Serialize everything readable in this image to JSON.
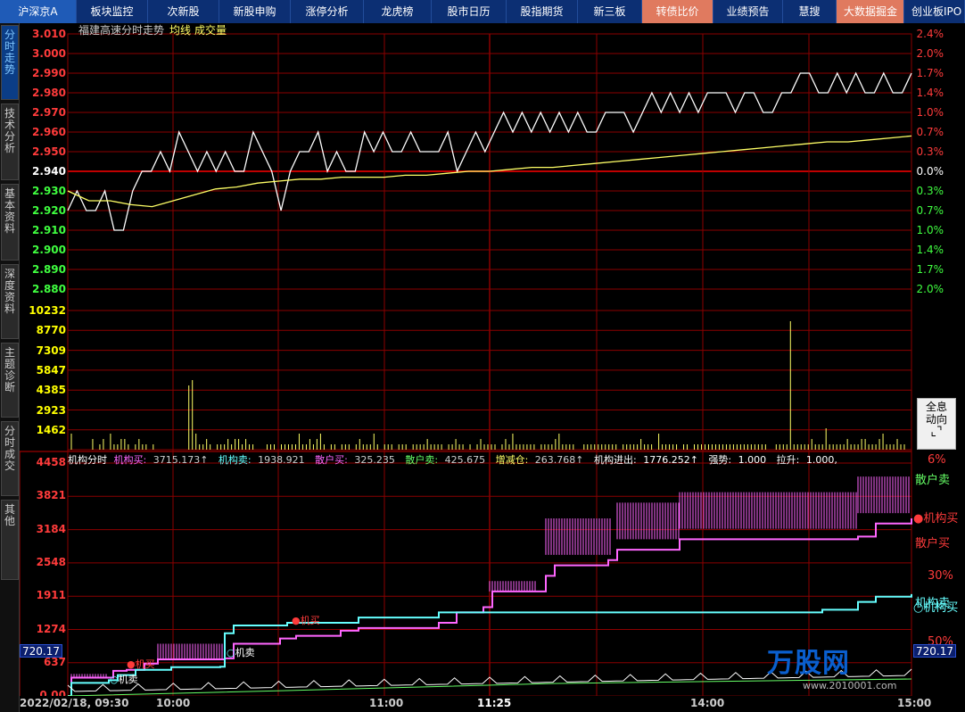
{
  "topnav": {
    "tabs": [
      {
        "label": "沪深京A",
        "style": "first"
      },
      {
        "label": "板块监控"
      },
      {
        "label": "次新股"
      },
      {
        "label": "新股申购"
      },
      {
        "label": "涨停分析"
      },
      {
        "label": "龙虎榜"
      },
      {
        "label": "股市日历"
      },
      {
        "label": "股指期货"
      },
      {
        "label": "新三板"
      },
      {
        "label": "转债比价",
        "style": "hl"
      },
      {
        "label": "业绩预告"
      },
      {
        "label": "慧搜"
      },
      {
        "label": "大数据掘金",
        "style": "hl"
      },
      {
        "label": "创业板IPO"
      }
    ]
  },
  "sidetabs": [
    {
      "label": "分时走势",
      "active": true
    },
    {
      "label": "技术分析"
    },
    {
      "label": "基本资料"
    },
    {
      "label": "深度资料"
    },
    {
      "label": "主题诊断"
    },
    {
      "label": "分时成交"
    },
    {
      "label": "其他"
    }
  ],
  "chart_title": {
    "name": "福建高速分时走势",
    "ma": "均线",
    "vol": "成交量"
  },
  "price_axis": {
    "left": [
      "3.010",
      "3.000",
      "2.990",
      "2.980",
      "2.970",
      "2.960",
      "2.950",
      "2.940",
      "2.930",
      "2.920",
      "2.910",
      "2.900",
      "2.890",
      "2.880"
    ],
    "right": [
      "2.4%",
      "2.0%",
      "1.7%",
      "1.4%",
      "1.0%",
      "0.7%",
      "0.3%",
      "0.0%",
      "0.3%",
      "0.7%",
      "1.0%",
      "1.4%",
      "1.7%",
      "2.0%"
    ]
  },
  "volume_axis": [
    "10232",
    "8770",
    "7309",
    "5847",
    "4385",
    "2923",
    "1462"
  ],
  "indicator": {
    "name": "机构分时",
    "inst_buy_label": "机构买:",
    "inst_buy_val": "3715.173↑",
    "inst_sell_label": "机构卖:",
    "inst_sell_val": "1938.921",
    "retail_buy_label": "散户买:",
    "retail_buy_val": "325.235",
    "retail_sell_label": "散户卖:",
    "retail_sell_val": "425.675",
    "change_label": "增减仓:",
    "change_val": "263.768↑",
    "net_label": "机构进出:",
    "net_val": "1776.252↑",
    "strength_label": "强势:",
    "strength_val": "1.000",
    "pull_label": "拉升:",
    "pull_val": "1.000,"
  },
  "indicator_axis": [
    "4458",
    "3821",
    "3184",
    "2548",
    "1911",
    "1274",
    "637",
    "0.00"
  ],
  "indicator_right": {
    "top_pct": "6%",
    "mid_pct": "30%",
    "low_pct": "50%"
  },
  "legend": {
    "retail_sell": "散户卖",
    "inst_buy": "机构买",
    "retail_buy": "散户买",
    "inst_sell": "机构卖",
    "inst_buy2": "机构买"
  },
  "value_boxes": {
    "left": "720.17",
    "right": "720.17"
  },
  "markers": {
    "buy": "机买",
    "sell": "机卖"
  },
  "time_axis": {
    "start": "2022/02/18, 09:30",
    "t1000": "10:00",
    "t1100": "11:00",
    "cursor": "11:25",
    "t1400": "14:00",
    "t1500": "15:00"
  },
  "fullinfo": {
    "line1": "全息",
    "line2": "动向"
  },
  "watermark": {
    "text": "万股网",
    "sub": "www.2010001.com"
  },
  "colors": {
    "price": "#ffffff",
    "avg": "#ffff66",
    "grid": "#8b0000",
    "inst_buy": "#ff66ff",
    "inst_sell": "#66ffff",
    "retail": "#ffff66"
  },
  "chart_data": [
    {
      "type": "line",
      "title": "福建高速分时走势",
      "x_range": [
        "09:30",
        "15:00"
      ],
      "ylim": [
        2.88,
        3.01
      ],
      "prev_close": 2.94,
      "series": [
        {
          "name": "分时",
          "values": [
            2.92,
            2.93,
            2.92,
            2.92,
            2.93,
            2.91,
            2.91,
            2.93,
            2.94,
            2.94,
            2.95,
            2.94,
            2.96,
            2.95,
            2.94,
            2.95,
            2.94,
            2.95,
            2.94,
            2.94,
            2.96,
            2.95,
            2.94,
            2.92,
            2.94,
            2.95,
            2.95,
            2.96,
            2.94,
            2.95,
            2.94,
            2.94,
            2.96,
            2.95,
            2.96,
            2.95,
            2.95,
            2.96,
            2.95,
            2.95,
            2.95,
            2.96,
            2.94,
            2.95,
            2.96,
            2.95,
            2.96,
            2.97,
            2.96,
            2.97,
            2.96,
            2.97,
            2.96,
            2.97,
            2.96,
            2.97,
            2.96,
            2.96,
            2.97,
            2.97,
            2.97,
            2.96,
            2.97,
            2.98,
            2.97,
            2.98,
            2.97,
            2.98,
            2.97,
            2.98,
            2.98,
            2.98,
            2.97,
            2.98,
            2.98,
            2.97,
            2.97,
            2.98,
            2.98,
            2.99,
            2.99,
            2.98,
            2.98,
            2.99,
            2.98,
            2.99,
            2.98,
            2.98,
            2.99,
            2.98,
            2.98,
            2.99
          ]
        },
        {
          "name": "均线",
          "values": [
            2.93,
            2.925,
            2.925,
            2.923,
            2.922,
            2.925,
            2.928,
            2.931,
            2.932,
            2.934,
            2.935,
            2.936,
            2.936,
            2.937,
            2.937,
            2.937,
            2.938,
            2.938,
            2.939,
            2.94,
            2.94,
            2.941,
            2.942,
            2.942,
            2.943,
            2.944,
            2.945,
            2.946,
            2.947,
            2.948,
            2.949,
            2.95,
            2.951,
            2.952,
            2.953,
            2.954,
            2.955,
            2.955,
            2.956,
            2.957,
            2.958
          ]
        }
      ]
    }
  ]
}
